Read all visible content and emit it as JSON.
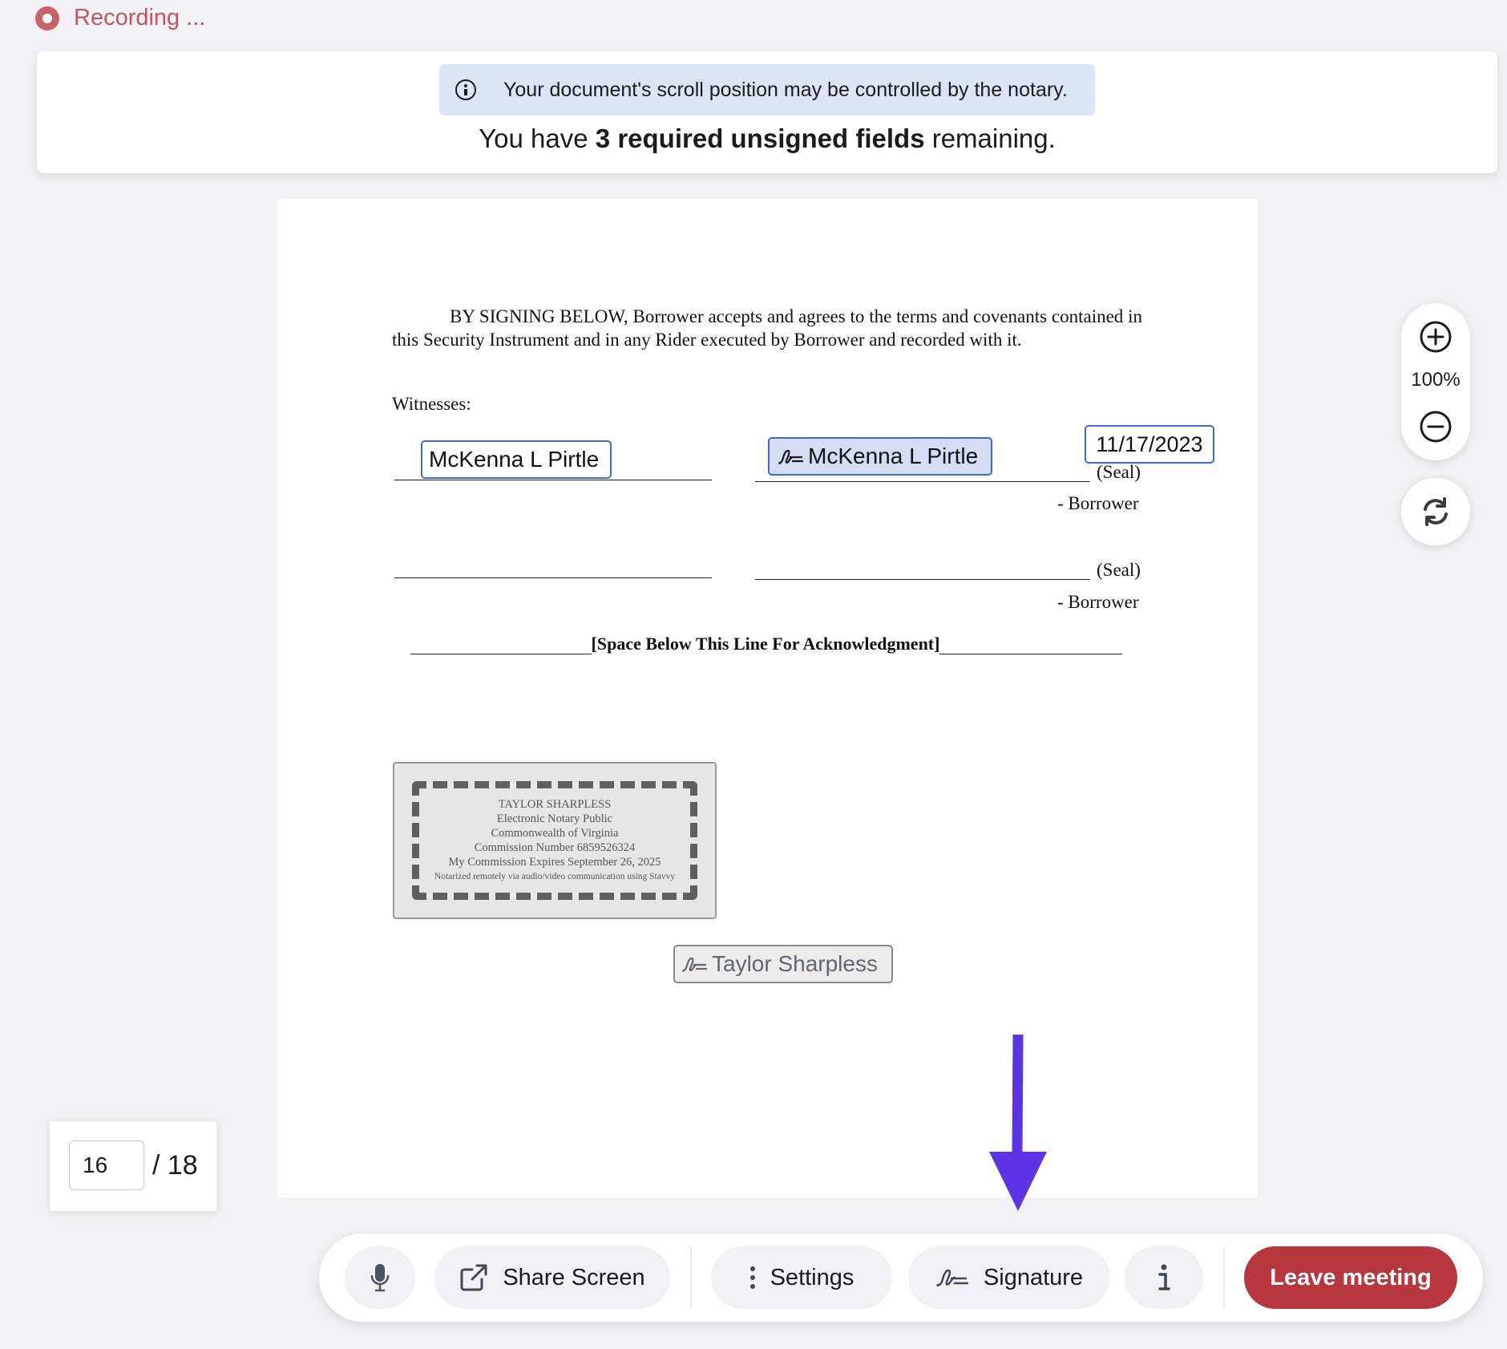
{
  "recording": {
    "label": "Recording ..."
  },
  "banner": {
    "notice": "Your document's scroll position may be controlled by the notary.",
    "remaining_prefix": "You have ",
    "remaining_bold": "3 required unsigned fields",
    "remaining_suffix": " remaining."
  },
  "document": {
    "paragraph": "BY SIGNING BELOW, Borrower accepts and agrees to the terms and covenants contained in this Security Instrument and in any Rider executed by Borrower and recorded with it.",
    "witnesses_label": "Witnesses:",
    "witness_signature": "McKenna L Pirtle",
    "borrower_signature": "McKenna L Pirtle",
    "date_field": "11/17/2023",
    "seal_label": "(Seal)",
    "borrower_label": "- Borrower",
    "ack_text": "[Space Below This Line For Acknowledgment]",
    "notary_signature": "Taylor Sharpless",
    "stamp": {
      "line1": "TAYLOR SHARPLESS",
      "line2": "Electronic Notary Public",
      "line3": "Commonwealth of Virginia",
      "line4": "Commission Number 6859526324",
      "line5": "My Commission Expires September 26, 2025",
      "line6": "Notarized remotely via audio/video communication using Stavvy"
    }
  },
  "zoom": {
    "level": "100%"
  },
  "pager": {
    "current": "16",
    "total": "/ 18"
  },
  "toolbar": {
    "share_screen": "Share Screen",
    "settings": "Settings",
    "signature": "Signature",
    "leave": "Leave meeting"
  },
  "colors": {
    "accent_blue": "#3f68d3",
    "leave_red": "#b8373e",
    "arrow_purple": "#5b35e6",
    "recording_red": "#c0575d"
  }
}
